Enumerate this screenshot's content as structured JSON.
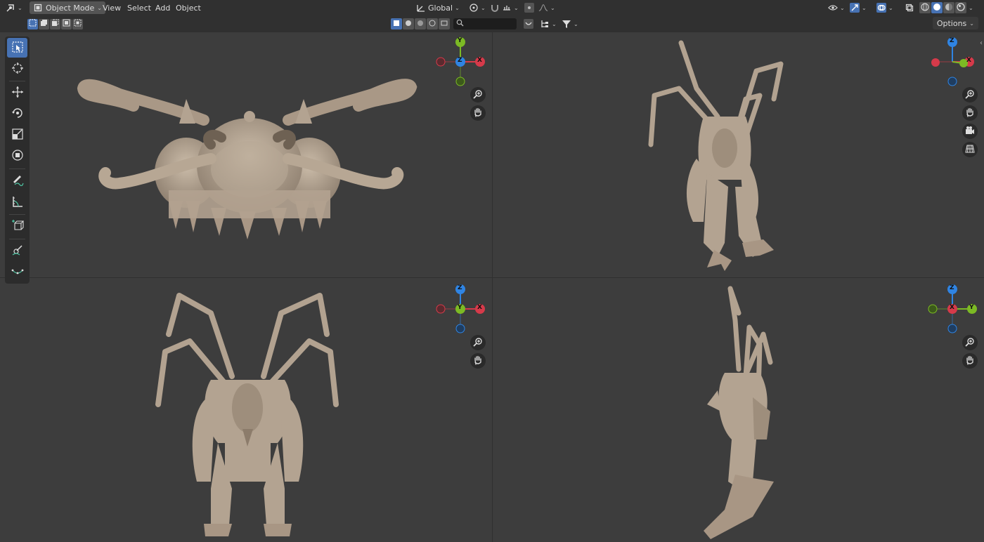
{
  "header": {
    "mode_label": "Object Mode",
    "menus": [
      "View",
      "Select",
      "Add",
      "Object"
    ],
    "transform_orientation": "Global",
    "options_label": "Options",
    "search_placeholder": ""
  },
  "viewports": {
    "top_left": {
      "gizmo": {
        "top": "Y",
        "center": "Z",
        "right": "X"
      }
    },
    "top_right": {
      "gizmo": {
        "top": "Z",
        "right": "X"
      }
    },
    "bottom_left": {
      "gizmo": {
        "top": "Z",
        "center": "Y",
        "right": "X"
      }
    },
    "bottom_right": {
      "gizmo": {
        "top": "Z",
        "center": "X",
        "right": "Y"
      }
    }
  },
  "colors": {
    "x_axis": "#d63a4a",
    "y_axis": "#7cba24",
    "z_axis": "#2f84e3",
    "accent": "#4772b3",
    "model": "#b9aa98"
  },
  "icons": {
    "tools": [
      "select-box-icon",
      "cursor-icon",
      "move-icon",
      "rotate-icon",
      "scale-icon",
      "transform-icon",
      "annotate-icon",
      "measure-icon",
      "add-cube-icon",
      "sculpt-icon",
      "curve-icon"
    ],
    "navigation": [
      "zoom-icon",
      "hand-pan-icon",
      "camera-icon",
      "grid-icon"
    ]
  }
}
